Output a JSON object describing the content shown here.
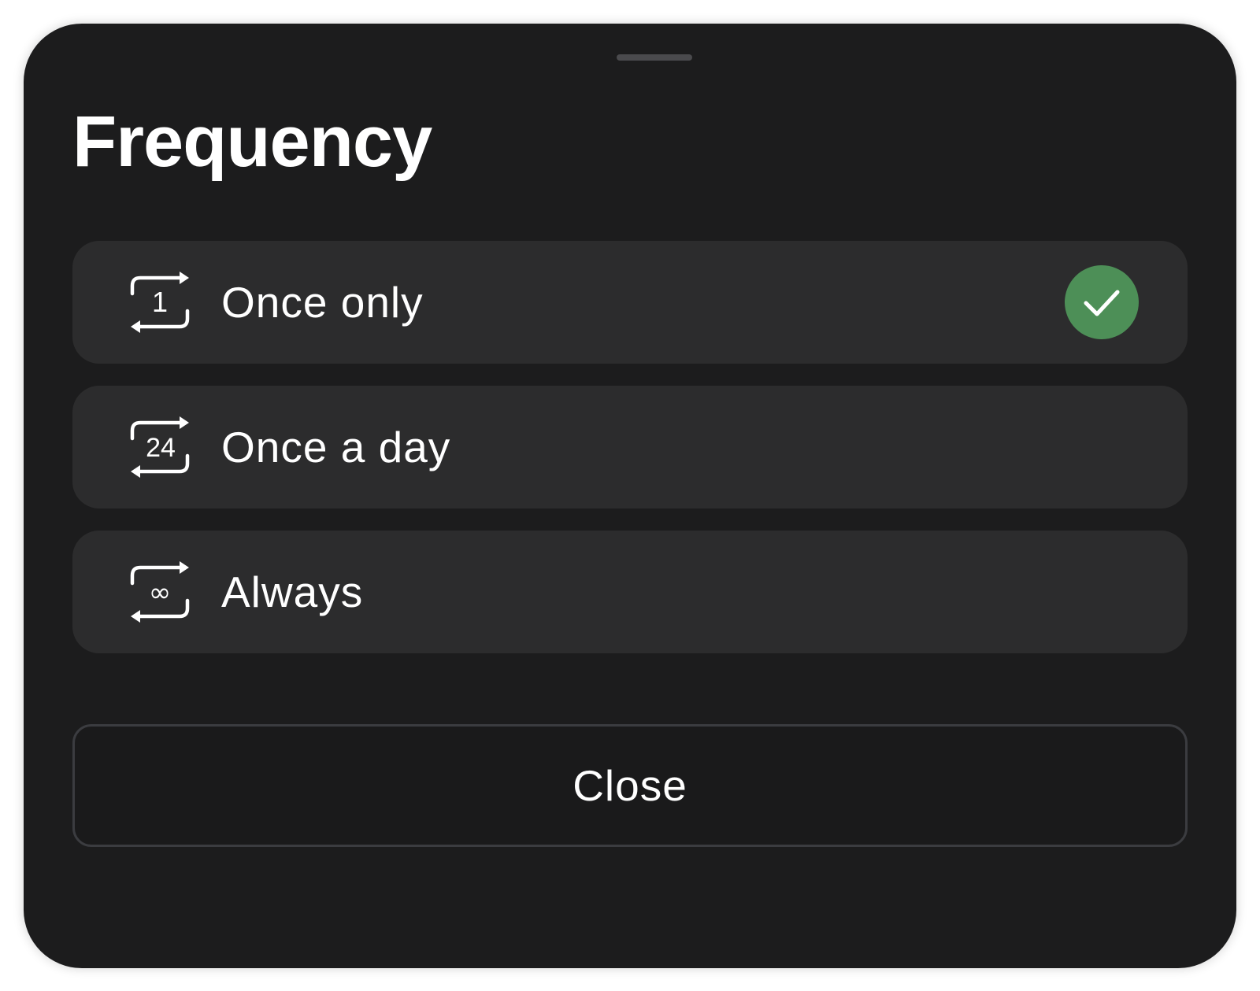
{
  "sheet": {
    "title": "Frequency",
    "options": [
      {
        "label": "Once only",
        "icon": "repeat-once-icon",
        "icon_text": "1",
        "selected": true
      },
      {
        "label": "Once a day",
        "icon": "repeat-daily-icon",
        "icon_text": "24",
        "selected": false
      },
      {
        "label": "Always",
        "icon": "repeat-always-icon",
        "icon_text": "∞",
        "selected": false
      }
    ],
    "selected_indicator_icon": "checkmark-icon",
    "close_label": "Close"
  },
  "colors": {
    "sheet_background": "#1c1c1d",
    "option_background": "#2c2c2d",
    "selected_accent": "#4d8f57",
    "close_border": "#3b3c40",
    "text": "#ffffff"
  }
}
